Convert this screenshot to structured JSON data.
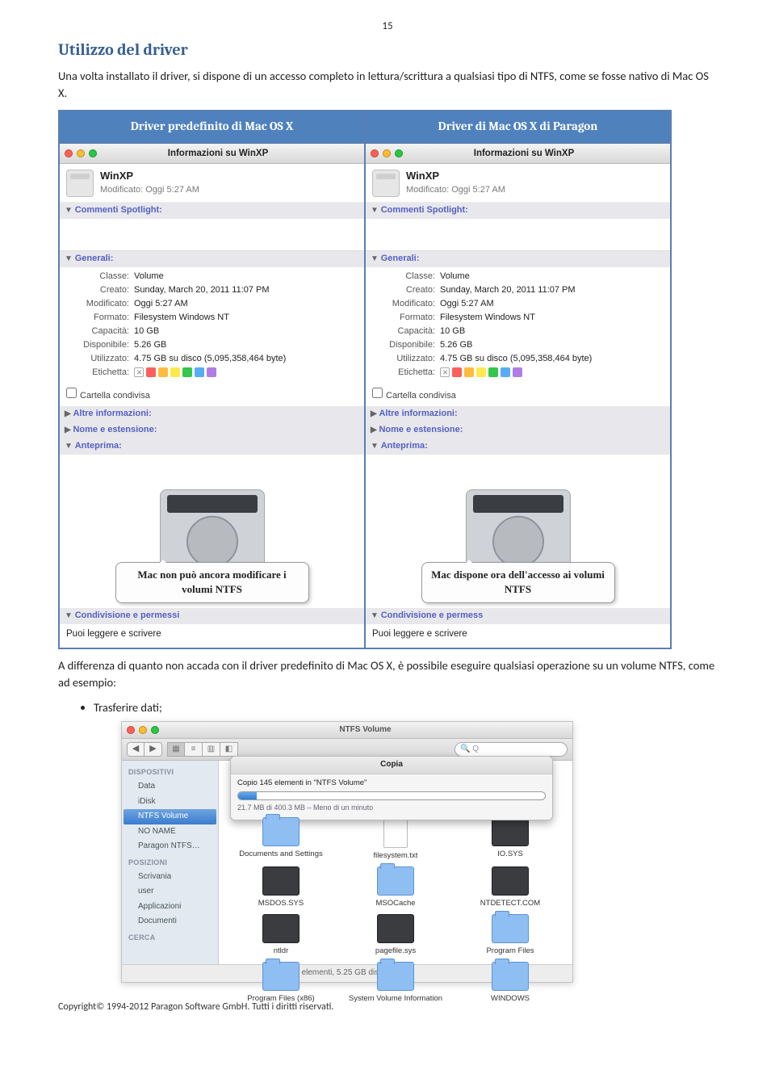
{
  "page_number": "15",
  "heading": "Utilizzo del driver",
  "intro": "Una volta installato il driver, si dispone di un accesso completo in lettura/scrittura a qualsiasi tipo di NTFS, come se fosse nativo di Mac OS X.",
  "table": {
    "col1": "Driver predefinito di Mac OS X",
    "col2": "Driver di Mac OS X di Paragon"
  },
  "info_window": {
    "title": "Informazioni su WinXP",
    "drive": "WinXP",
    "modified": "Modificato: Oggi 5:27 AM",
    "spotlight_hdr": "Commenti Spotlight:",
    "generals_hdr": "Generali:",
    "rows": {
      "classe_lbl": "Classe:",
      "classe_val": "Volume",
      "creato_lbl": "Creato:",
      "creato_val": "Sunday, March 20, 2011 11:07 PM",
      "mod_lbl": "Modificato:",
      "mod_val": "Oggi 5:27 AM",
      "formato_lbl": "Formato:",
      "formato_val": "Filesystem Windows NT",
      "cap_lbl": "Capacità:",
      "cap_val": "10 GB",
      "disp_lbl": "Disponibile:",
      "disp_val": "5.26 GB",
      "util_lbl": "Utilizzato:",
      "util_val": "4.75 GB su disco (5,095,358,464 byte)",
      "etichetta_lbl": "Etichetta:"
    },
    "shared": "Cartella condivisa",
    "altre": "Altre informazioni:",
    "nome_ext": "Nome e estensione:",
    "anteprima": "Anteprima:",
    "perm_hdr_partial_left": "Condivisione e permessi",
    "perm_hdr_partial_right": "Condivisione e permess",
    "perm_text": "Puoi leggere e scrivere",
    "bubble_left": "Mac non può ancora modificare i volumi NTFS",
    "bubble_right": "Mac dispone ora dell'accesso ai volumi NTFS"
  },
  "para2": "A differenza di quanto non accada con il driver predefinito di Mac OS X, è possibile eseguire qualsiasi operazione su un volume NTFS, come ad esempio:",
  "bullet1": "Trasferire dati;",
  "finder": {
    "title": "NTFS Volume",
    "search_placeholder": "Q",
    "sb_dev": "DISPOSITIVI",
    "sb_items_dev": [
      "Data",
      "iDisk",
      "NTFS Volume",
      "NO NAME",
      "Paragon NTFS…"
    ],
    "sb_pos": "POSIZIONI",
    "sb_items_pos": [
      "Scrivania",
      "user",
      "Applicazioni",
      "Documenti"
    ],
    "sb_cerca": "CERCA",
    "copy_title": "Copia",
    "copy_line1": "Copio 145 elementi in \"NTFS Volume\"",
    "copy_line2": "21.7 MB di 400.3 MB – Meno di un minuto",
    "files": [
      "Documents and Settings",
      "filesystem.txt",
      "IO.SYS",
      "MSDOS.SYS",
      "MSOCache",
      "NTDETECT.COM",
      "ntldr",
      "pagefile.sys",
      "Program Files",
      "Program Files (x86)",
      "System Volume Information",
      "WINDOWS"
    ],
    "status": "16 elementi, 5.25 GB disponibili"
  },
  "footer": "Copyright© 1994-2012 Paragon Software GmbH. Tutti i diritti riservati."
}
